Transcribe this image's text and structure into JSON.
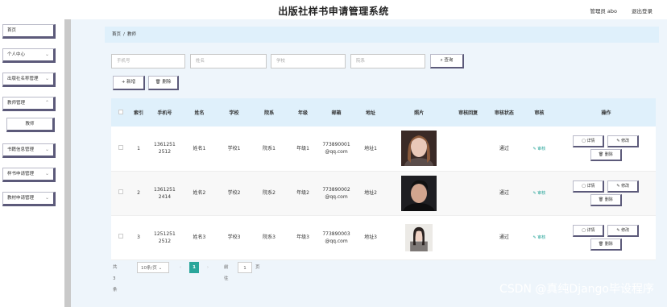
{
  "header": {
    "app_title": "出版社样书申请管理系统",
    "user_label": "管理员 abo",
    "logout_label": "退出登录"
  },
  "sidebar": {
    "items": [
      {
        "label": "首页",
        "has_arrow": false
      },
      {
        "label": "个人中心",
        "has_arrow": true
      },
      {
        "label": "出版社名称管理",
        "has_arrow": true
      },
      {
        "label": "教师管理",
        "has_arrow": true
      },
      {
        "label": "教师",
        "has_arrow": false
      },
      {
        "label": "书籍信息管理",
        "has_arrow": true
      },
      {
        "label": "样书申请管理",
        "has_arrow": true
      },
      {
        "label": "教材申请管理",
        "has_arrow": true
      }
    ]
  },
  "breadcrumb": {
    "home": "首页",
    "separator": "/",
    "current": "教师"
  },
  "search": {
    "placeholders": [
      "手机号",
      "姓名",
      "学校",
      "院系"
    ],
    "button_label": "查询",
    "button_icon": "search-icon"
  },
  "toolbar": {
    "add_label": "新增",
    "delete_label": "删除"
  },
  "table": {
    "headers": [
      "索引",
      "手机号",
      "姓名",
      "学校",
      "院系",
      "年级",
      "邮箱",
      "地址",
      "照片",
      "审核回复",
      "审核状态",
      "审核",
      "操作"
    ],
    "rows": [
      {
        "index": "1",
        "phone": "13612512512",
        "name": "姓名1",
        "school": "学校1",
        "dept": "院系1",
        "grade": "年级1",
        "email": "773890001@qq.com",
        "address": "地址1",
        "reply": "",
        "status": "通过",
        "audit": "审核"
      },
      {
        "index": "2",
        "phone": "13612512414",
        "name": "姓名2",
        "school": "学校2",
        "dept": "院系2",
        "grade": "年级2",
        "email": "773890002@qq.com",
        "address": "地址2",
        "reply": "",
        "status": "通过",
        "audit": "审核"
      },
      {
        "index": "3",
        "phone": "12512512512",
        "name": "姓名3",
        "school": "学校3",
        "dept": "院系3",
        "grade": "年级3",
        "email": "773890003@qq.com",
        "address": "地址3",
        "reply": "",
        "status": "通过",
        "audit": "审核"
      }
    ],
    "op_labels": {
      "detail": "详情",
      "edit": "修改",
      "delete": "删除"
    }
  },
  "pagination": {
    "total_label": "共 3 条",
    "page_size_label": "10条/页",
    "prev": "‹",
    "current_page": "1",
    "next": "›",
    "goto_label": "前往",
    "goto_value": "1",
    "page_suffix": "页"
  },
  "watermark": "CSDN @真纯Django毕设程序",
  "colors": {
    "accent": "#2aa69b",
    "header_bg": "#dff0fb",
    "button_shadow": "#5c5a7a"
  }
}
